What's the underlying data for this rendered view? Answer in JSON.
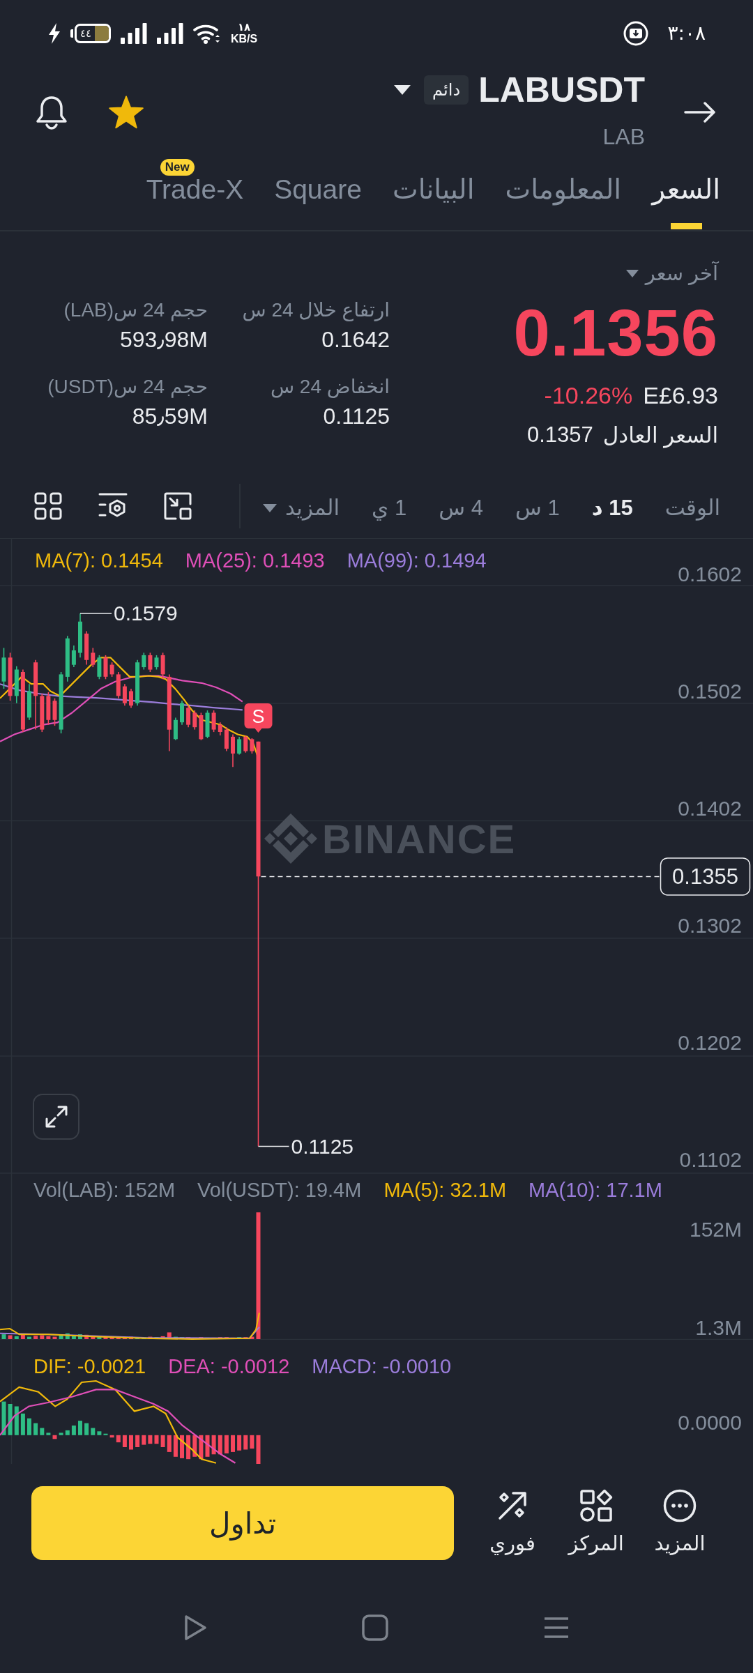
{
  "status_bar": {
    "battery": "٤٤",
    "speed": "١٨",
    "speed_unit": "KB/S",
    "time": "٣:٠٨"
  },
  "header": {
    "symbol": "LABUSDT",
    "contract_badge": "دائم",
    "base_asset": "LAB",
    "favorite": true
  },
  "tabs": [
    {
      "label": "السعر",
      "selected": true
    },
    {
      "label": "المعلومات",
      "selected": false
    },
    {
      "label": "البيانات",
      "selected": false
    },
    {
      "label": "Square",
      "selected": false
    },
    {
      "label": "Trade-X",
      "selected": false,
      "badge": "New"
    }
  ],
  "price_panel": {
    "label": "آخر سعر",
    "last_price": "0.1356",
    "fiat_price": "E£6.93",
    "change": "-10.26%",
    "fair_price_label": "السعر العادل",
    "fair_price": "0.1357"
  },
  "stats": [
    {
      "label": "ارتفاع خلال 24 س",
      "value": "0.1642"
    },
    {
      "label": "حجم 24 س(LAB)",
      "value": "593٫98M"
    },
    {
      "label": "انخفاض 24 س",
      "value": "0.1125"
    },
    {
      "label": "حجم 24 س(USDT)",
      "value": "85٫59M"
    }
  ],
  "intervals": {
    "options": [
      {
        "label": "الوقت",
        "selected": false
      },
      {
        "label": "15 د",
        "selected": true
      },
      {
        "label": "1 س",
        "selected": false
      },
      {
        "label": "4 س",
        "selected": false
      },
      {
        "label": "1 ي",
        "selected": false
      }
    ],
    "more": "المزيد"
  },
  "price_chart": {
    "legend": [
      {
        "text": "MA(99): 0.1494",
        "color": "#9b7ddb"
      },
      {
        "text": "MA(25): 0.1493",
        "color": "#e04fb8"
      },
      {
        "text": "MA(7): 0.1454",
        "color": "#f0b90b"
      }
    ],
    "axis_labels": [
      "0.1602",
      "0.1502",
      "0.1402",
      "0.1302",
      "0.1202",
      "0.1102"
    ],
    "high_label": "0.1579",
    "low_label": "0.1125",
    "current_price": "0.1355",
    "signal": "S",
    "watermark": "BINANCE"
  },
  "volume_chart": {
    "legend": [
      {
        "text": "MA(10): 17.1M",
        "color": "#9b7ddb"
      },
      {
        "text": "MA(5): 32.1M",
        "color": "#f0b90b"
      },
      {
        "text": "Vol(USDT): 19.4M",
        "color": "#848e9c"
      },
      {
        "text": "Vol(LAB): 152M",
        "color": "#848e9c"
      }
    ],
    "axis_labels": [
      "152M",
      "1.3M"
    ]
  },
  "macd_chart": {
    "legend": [
      {
        "text": "MACD: -0.0010",
        "color": "#9b7ddb"
      },
      {
        "text": "DEA: -0.0012",
        "color": "#e04fb8"
      },
      {
        "text": "DIF: -0.0021",
        "color": "#f0b90b"
      }
    ],
    "axis_labels": [
      "0.0000"
    ]
  },
  "bottom_bar": {
    "items": [
      {
        "kind": "more",
        "label": "المزيد"
      },
      {
        "kind": "positions",
        "label": "المركز"
      },
      {
        "kind": "convert",
        "label": "فوري"
      }
    ],
    "trade_button": "تداول"
  }
}
